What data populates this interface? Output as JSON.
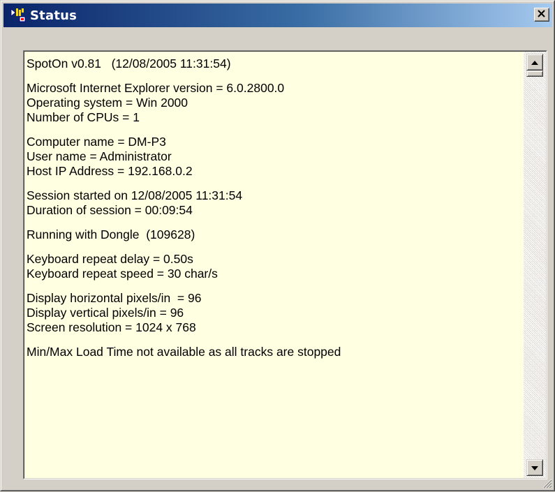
{
  "window": {
    "title": "Status",
    "icon": "spoton-app-icon",
    "close_icon": "close-icon"
  },
  "status_text": {
    "lines": [
      "SpotOn v0.81   (12/08/2005 11:31:54)",
      "",
      "Microsoft Internet Explorer version = 6.0.2800.0",
      "Operating system = Win 2000",
      "Number of CPUs = 1",
      "",
      "Computer name = DM-P3",
      "User name = Administrator",
      "Host IP Address = 192.168.0.2",
      "",
      "Session started on 12/08/2005 11:31:54",
      "Duration of session = 00:09:54",
      "",
      "Running with Dongle  (109628)",
      "",
      "Keyboard repeat delay = 0.50s",
      "Keyboard repeat speed = 30 char/s",
      "",
      "Display horizontal pixels/in  = 96",
      "Display vertical pixels/in = 96",
      "Screen resolution = 1024 x 768",
      "",
      "Min/Max Load Time not available as all tracks are stopped"
    ]
  },
  "scrollbar": {
    "up_icon": "scroll-up-arrow-icon",
    "down_icon": "scroll-down-arrow-icon",
    "position": 0.0
  },
  "colors": {
    "text_background": "#ffffe1",
    "title_gradient_start": "#0a246a",
    "title_gradient_end": "#a6caf0"
  }
}
